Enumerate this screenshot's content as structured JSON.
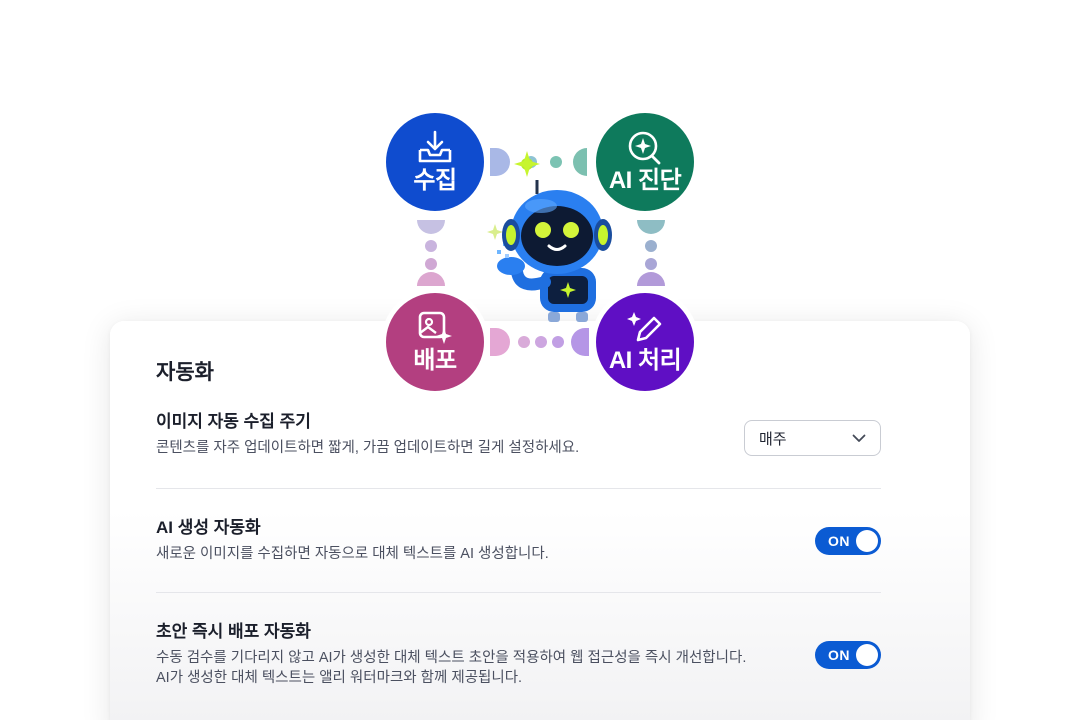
{
  "hero": {
    "nodes": [
      {
        "label": "수집",
        "icon": "inbox-download-icon",
        "color": "#0f4ccf"
      },
      {
        "label": "AI 진단",
        "icon": "sparkle-search-icon",
        "color": "#0e7a5c"
      },
      {
        "label": "배포",
        "icon": "image-sparkle-icon",
        "color": "#b33f80"
      },
      {
        "label": "AI 처리",
        "icon": "magic-pen-icon",
        "color": "#5f0fc4"
      }
    ],
    "mascot": "robot-mascot"
  },
  "settings": {
    "title": "자동화",
    "collect": {
      "title": "이미지 자동 수집 주기",
      "desc": "콘텐츠를 자주 업데이트하면 짧게, 가끔 업데이트하면 길게 설정하세요.",
      "select_value": "매주"
    },
    "ai_generate": {
      "title": "AI 생성 자동화",
      "desc": "새로운 이미지를 수집하면 자동으로 대체 텍스트를 AI 생성합니다.",
      "toggle": "ON"
    },
    "deploy": {
      "title": "초안 즉시 배포 자동화",
      "desc_line1": "수동 검수를 기다리지 않고 AI가 생성한 대체 텍스트 초안을 적용하여 웹 접근성을 즉시 개선합니다.",
      "desc_line2": "AI가 생성한 대체 텍스트는 앨리 워터마크와 함께 제공됩니다.",
      "toggle": "ON"
    }
  }
}
